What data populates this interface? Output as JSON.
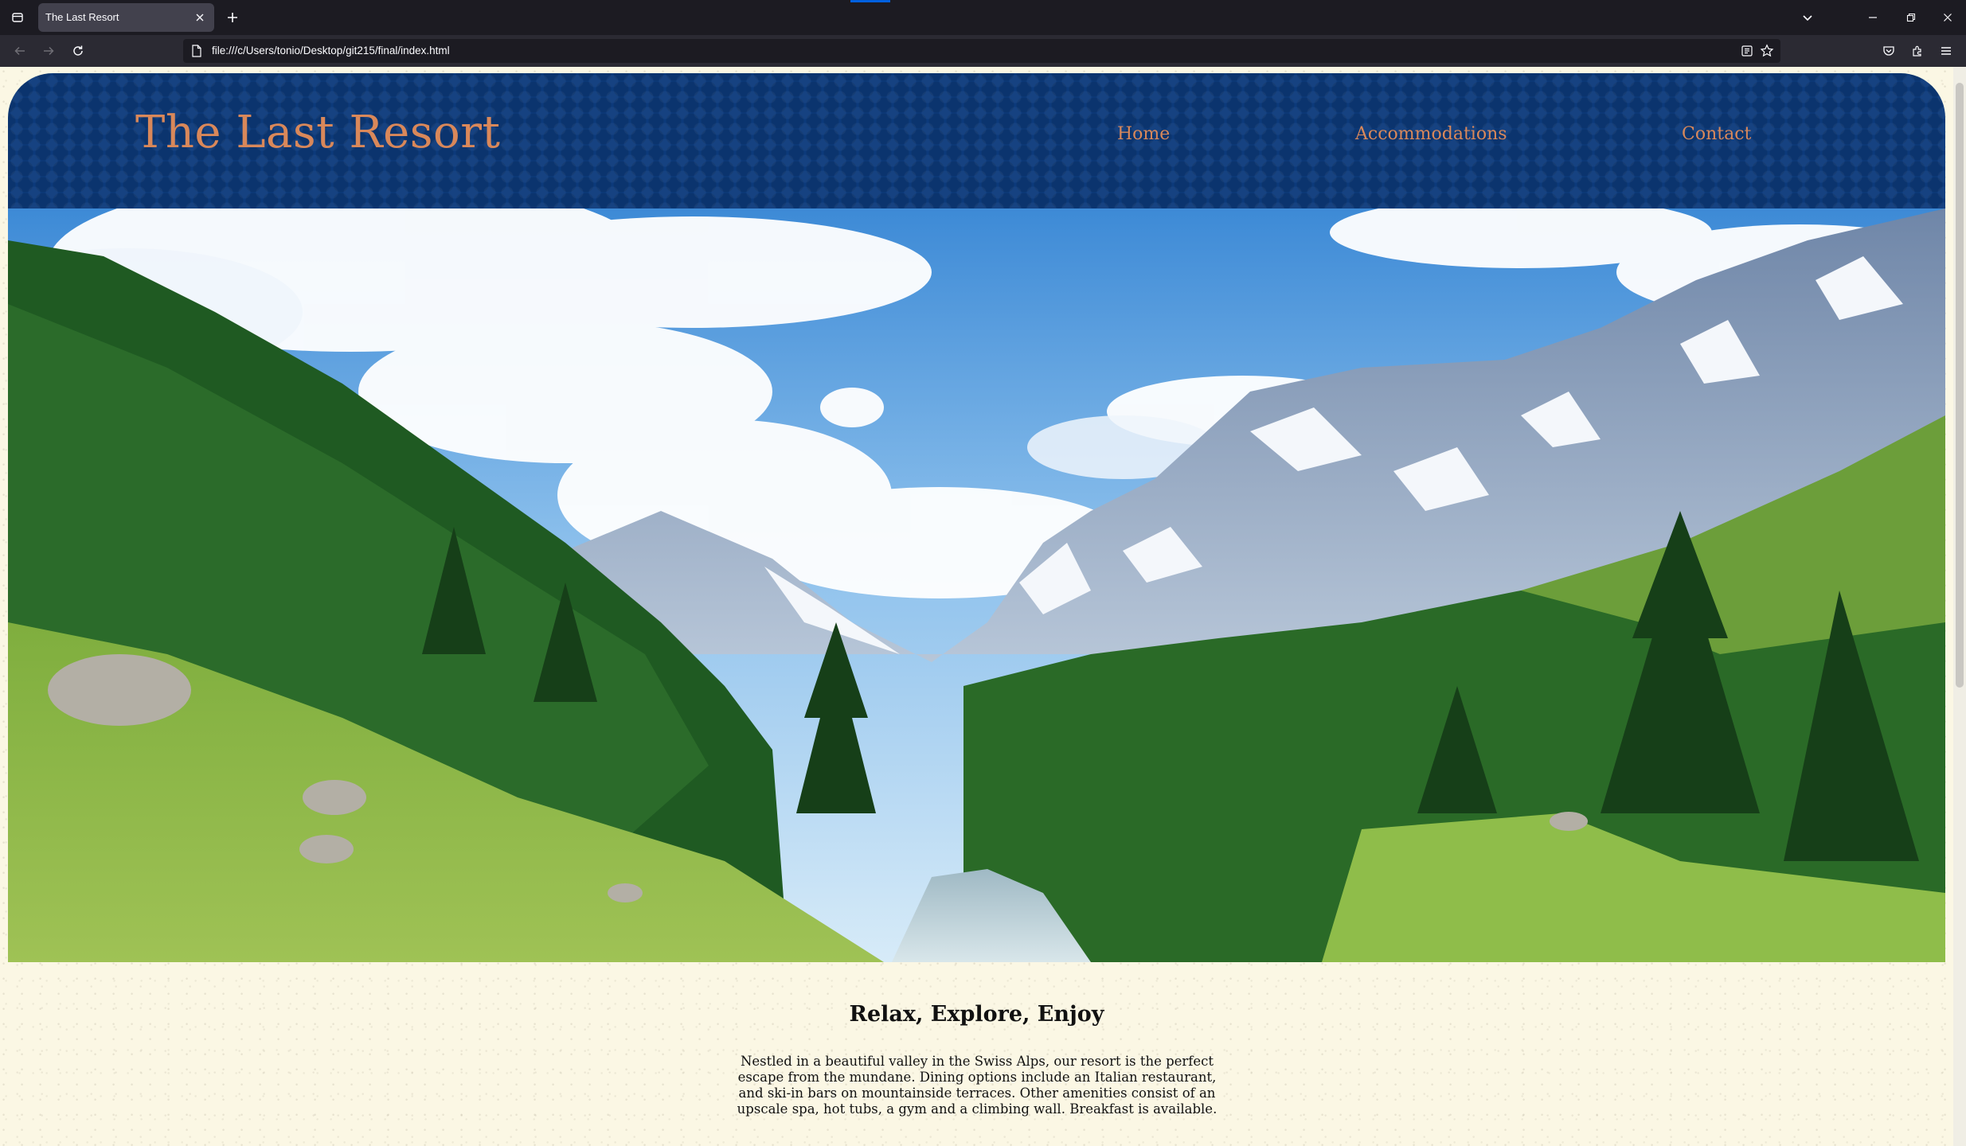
{
  "browser": {
    "tab_title": "The Last Resort",
    "url": "file:///c/Users/tonio/Desktop/git215/final/index.html"
  },
  "site": {
    "logo": "The Last Resort",
    "nav": [
      "Home",
      "Accommodations",
      "Contact"
    ],
    "hero_alt": "Alpine valley with pine forest, river and snowy mountains",
    "heading": "Relax, Explore, Enjoy",
    "paragraph": "Nestled in a beautiful valley in the Swiss Alps, our resort is the perfect escape from the mundane. Dining options include an Italian restaurant, and ski-in bars on mountainside terraces. Other amenities consist of an upscale spa, hot tubs, a gym and a climbing wall. Breakfast is available."
  },
  "colors": {
    "header_bg": "#0c3a7b",
    "accent": "#d9885a",
    "page_bg": "#fbf7e4"
  }
}
